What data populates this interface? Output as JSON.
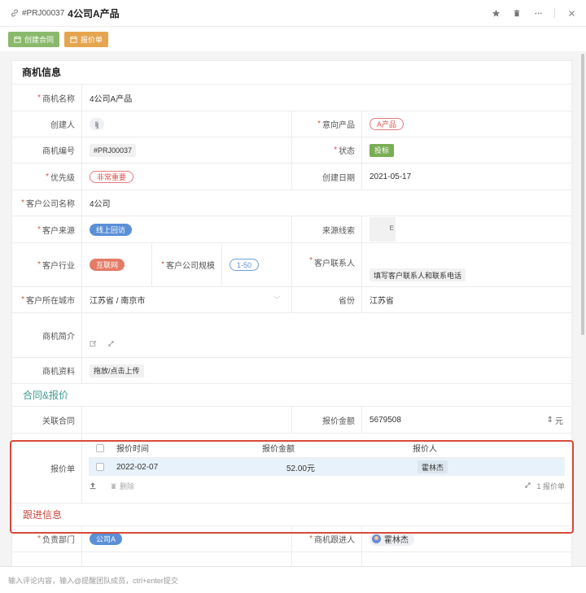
{
  "window": {
    "code": "#PRJ00037",
    "title": "4公司A产品"
  },
  "toolbar": {
    "create_contract": "创建合同",
    "quote": "报价单"
  },
  "card": {
    "title": "商机信息",
    "fields": {
      "name_label": "商机名称",
      "name_value": "4公司A产品",
      "creator_label": "创建人",
      "creator_value": "lj",
      "product_label": "意向产品",
      "product_value": "A产品",
      "number_label": "商机编号",
      "number_value": "#PRJ00037",
      "status_label": "状态",
      "status_value": "投标",
      "priority_label": "优先级",
      "priority_value": "非常重要",
      "created_date_label": "创建日期",
      "created_date_value": "2021-05-17",
      "company_label": "客户公司名称",
      "company_value": "4公司",
      "source_label": "客户来源",
      "source_value": "线上回访",
      "lead_label": "来源线索",
      "lead_value": "E",
      "industry_label": "客户行业",
      "industry_value": "互联网",
      "scale_label": "客户公司规模",
      "scale_value": "1-50",
      "contact_label": "客户联系人",
      "contact_value": "填写客户联系人和联系电话",
      "city_label": "客户所在城市",
      "city_value": "江苏省 / 南京市",
      "province_label": "省份",
      "province_value": "江苏省",
      "intro_label": "商机简介",
      "files_label": "商机资料",
      "files_value": "拖放/点击上传"
    }
  },
  "contract_section": {
    "title": "合同&报价",
    "related_label": "关联合同",
    "amount_label": "报价金额",
    "amount_value": "5679508",
    "amount_unit": "元",
    "quote_label": "报价单",
    "quote_table": {
      "headers": [
        "报价时间",
        "报价金额",
        "报价人"
      ],
      "rows": [
        {
          "date": "2022-02-07",
          "amount": "52.00元",
          "person": "霍林杰"
        }
      ],
      "delete_label": "删除",
      "count_label": "1 报价单"
    }
  },
  "follow_section": {
    "title": "跟进信息",
    "dept_label": "负责部门",
    "dept_value": "公司A",
    "follower_label": "商机跟进人",
    "follower_value": "霍林杰"
  },
  "comment": {
    "placeholder": "输入评论内容，输入@提醒团队成员，ctrl+enter提交"
  },
  "colors": {
    "accent_green": "#8ab96b",
    "accent_orange": "#e5a54f",
    "highlight_red": "#d84a3a",
    "section_teal": "#3f9b8f",
    "section_red": "#c84a40"
  }
}
